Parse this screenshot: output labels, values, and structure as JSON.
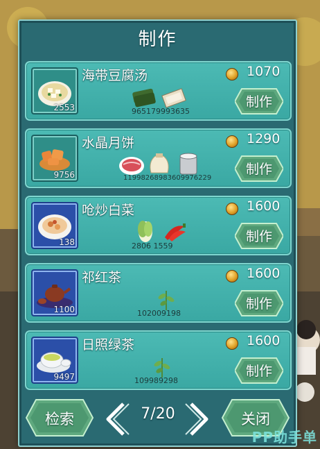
{
  "panel": {
    "title": "制作"
  },
  "recipes": [
    {
      "name": "海带豆腐汤",
      "stock": "2553",
      "price": "1070",
      "materials": [
        "9651",
        "7999",
        "3635"
      ],
      "materials_text": "965179993635",
      "icons": [
        "seaweed-icon",
        "tofu-icon"
      ]
    },
    {
      "name": "水晶月饼",
      "stock": "9756",
      "price": "1290",
      "materials_text": "11998 26989 3660 76229",
      "materials_text_raw": "11998268983609976229",
      "icons": [
        "meat-icon",
        "flour-sack-icon",
        "lard-bucket-icon"
      ]
    },
    {
      "name": "呛炒白菜",
      "stock": "138",
      "price": "1600",
      "materials_text": "2806  1559",
      "icons": [
        "cabbage-icon",
        "chili-icon"
      ]
    },
    {
      "name": "祁红茶",
      "stock": "1100",
      "price": "1600",
      "materials_text": "102009198",
      "icons": [
        "tea-leaf-icon"
      ]
    },
    {
      "name": "日照绿茶",
      "stock": "9497",
      "price": "1600",
      "materials_text": "109989298",
      "icons": [
        "tea-leaf-icon"
      ]
    }
  ],
  "make_label": "制作",
  "footer": {
    "search_label": "检索",
    "page": "7/20",
    "close_label": "关闭"
  },
  "watermark": "PP助手单"
}
